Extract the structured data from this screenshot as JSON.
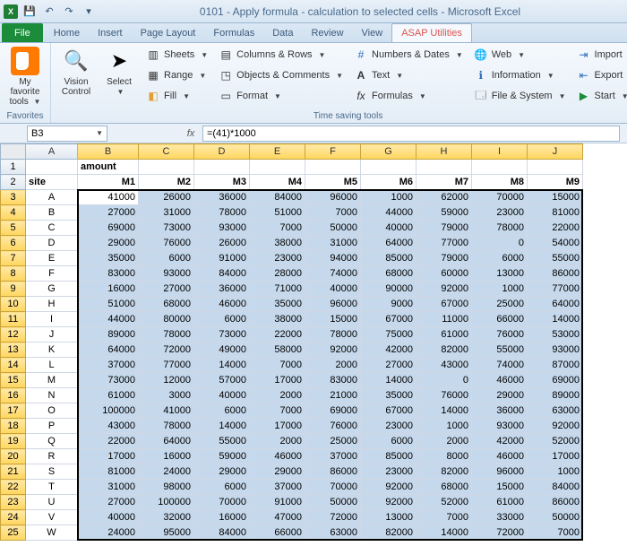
{
  "app": {
    "title": "0101 - Apply formula - calculation to selected cells  -  Microsoft Excel"
  },
  "qat": {
    "save": "💾",
    "undo": "↶",
    "redo": "↷",
    "more": "▾"
  },
  "tabs": {
    "file": "File",
    "items": [
      "Home",
      "Insert",
      "Page Layout",
      "Formulas",
      "Data",
      "Review",
      "View",
      "ASAP Utilities"
    ],
    "active": 7
  },
  "ribbon": {
    "favorites": {
      "label": "Favorites",
      "btn": "My favorite tools"
    },
    "timesaving": {
      "label": "Time saving tools",
      "vision": "Vision Control",
      "select": "Select",
      "col1": [
        "Sheets",
        "Range",
        "Fill"
      ],
      "col2": [
        "Columns & Rows",
        "Objects & Comments",
        "Format"
      ],
      "col3": [
        "Numbers & Dates",
        "Text",
        "Formulas"
      ],
      "col4": [
        "Web",
        "Information",
        "File & System"
      ],
      "col5": [
        "Import",
        "Export",
        "Start"
      ]
    }
  },
  "formula_bar": {
    "namebox": "B3",
    "fx": "fx",
    "formula": "=(41)*1000"
  },
  "grid": {
    "columns": [
      "A",
      "B",
      "C",
      "D",
      "E",
      "F",
      "G",
      "H",
      "I",
      "J"
    ],
    "row1": {
      "B": "amount"
    },
    "row2": {
      "A": "site",
      "headers": [
        "M1",
        "M2",
        "M3",
        "M4",
        "M5",
        "M6",
        "M7",
        "M8",
        "M9"
      ]
    },
    "sites": [
      "A",
      "B",
      "C",
      "D",
      "E",
      "F",
      "G",
      "H",
      "I",
      "J",
      "K",
      "L",
      "M",
      "N",
      "O",
      "P",
      "Q",
      "R",
      "S",
      "T",
      "U",
      "V",
      "W"
    ],
    "data": [
      [
        41000,
        26000,
        36000,
        84000,
        96000,
        1000,
        62000,
        70000,
        15000
      ],
      [
        27000,
        31000,
        78000,
        51000,
        7000,
        44000,
        59000,
        23000,
        81000
      ],
      [
        69000,
        73000,
        93000,
        7000,
        50000,
        40000,
        79000,
        78000,
        22000
      ],
      [
        29000,
        76000,
        26000,
        38000,
        31000,
        64000,
        77000,
        0,
        54000
      ],
      [
        35000,
        6000,
        91000,
        23000,
        94000,
        85000,
        79000,
        6000,
        55000
      ],
      [
        83000,
        93000,
        84000,
        28000,
        74000,
        68000,
        60000,
        13000,
        86000
      ],
      [
        16000,
        27000,
        36000,
        71000,
        40000,
        90000,
        92000,
        1000,
        77000
      ],
      [
        51000,
        68000,
        46000,
        35000,
        96000,
        9000,
        67000,
        25000,
        64000
      ],
      [
        44000,
        80000,
        6000,
        38000,
        15000,
        67000,
        11000,
        66000,
        14000
      ],
      [
        89000,
        78000,
        73000,
        22000,
        78000,
        75000,
        61000,
        76000,
        53000
      ],
      [
        64000,
        72000,
        49000,
        58000,
        92000,
        42000,
        82000,
        55000,
        93000
      ],
      [
        37000,
        77000,
        14000,
        7000,
        2000,
        27000,
        43000,
        74000,
        87000
      ],
      [
        73000,
        12000,
        57000,
        17000,
        83000,
        14000,
        0,
        46000,
        69000
      ],
      [
        61000,
        3000,
        40000,
        2000,
        21000,
        35000,
        76000,
        29000,
        89000
      ],
      [
        100000,
        41000,
        6000,
        7000,
        69000,
        67000,
        14000,
        36000,
        63000
      ],
      [
        43000,
        78000,
        14000,
        17000,
        76000,
        23000,
        1000,
        93000,
        92000
      ],
      [
        22000,
        64000,
        55000,
        2000,
        25000,
        6000,
        2000,
        42000,
        52000
      ],
      [
        17000,
        16000,
        59000,
        46000,
        37000,
        85000,
        8000,
        46000,
        17000
      ],
      [
        81000,
        24000,
        29000,
        29000,
        86000,
        23000,
        82000,
        96000,
        1000
      ],
      [
        31000,
        98000,
        6000,
        37000,
        70000,
        92000,
        68000,
        15000,
        84000
      ],
      [
        27000,
        100000,
        70000,
        91000,
        50000,
        92000,
        52000,
        61000,
        86000
      ],
      [
        40000,
        32000,
        16000,
        47000,
        72000,
        13000,
        7000,
        33000,
        50000
      ],
      [
        24000,
        95000,
        84000,
        66000,
        63000,
        82000,
        14000,
        72000,
        7000
      ]
    ],
    "selection": {
      "active": "B3",
      "range": "B3:J25"
    }
  },
  "chart_data": {
    "type": "table",
    "title": "amount",
    "row_labels": [
      "A",
      "B",
      "C",
      "D",
      "E",
      "F",
      "G",
      "H",
      "I",
      "J",
      "K",
      "L",
      "M",
      "N",
      "O",
      "P",
      "Q",
      "R",
      "S",
      "T",
      "U",
      "V",
      "W"
    ],
    "column_labels": [
      "M1",
      "M2",
      "M3",
      "M4",
      "M5",
      "M6",
      "M7",
      "M8",
      "M9"
    ],
    "values": [
      [
        41000,
        26000,
        36000,
        84000,
        96000,
        1000,
        62000,
        70000,
        15000
      ],
      [
        27000,
        31000,
        78000,
        51000,
        7000,
        44000,
        59000,
        23000,
        81000
      ],
      [
        69000,
        73000,
        93000,
        7000,
        50000,
        40000,
        79000,
        78000,
        22000
      ],
      [
        29000,
        76000,
        26000,
        38000,
        31000,
        64000,
        77000,
        0,
        54000
      ],
      [
        35000,
        6000,
        91000,
        23000,
        94000,
        85000,
        79000,
        6000,
        55000
      ],
      [
        83000,
        93000,
        84000,
        28000,
        74000,
        68000,
        60000,
        13000,
        86000
      ],
      [
        16000,
        27000,
        36000,
        71000,
        40000,
        90000,
        92000,
        1000,
        77000
      ],
      [
        51000,
        68000,
        46000,
        35000,
        96000,
        9000,
        67000,
        25000,
        64000
      ],
      [
        44000,
        80000,
        6000,
        38000,
        15000,
        67000,
        11000,
        66000,
        14000
      ],
      [
        89000,
        78000,
        73000,
        22000,
        78000,
        75000,
        61000,
        76000,
        53000
      ],
      [
        64000,
        72000,
        49000,
        58000,
        92000,
        42000,
        82000,
        55000,
        93000
      ],
      [
        37000,
        77000,
        14000,
        7000,
        2000,
        27000,
        43000,
        74000,
        87000
      ],
      [
        73000,
        12000,
        57000,
        17000,
        83000,
        14000,
        0,
        46000,
        69000
      ],
      [
        61000,
        3000,
        40000,
        2000,
        21000,
        35000,
        76000,
        29000,
        89000
      ],
      [
        100000,
        41000,
        6000,
        7000,
        69000,
        67000,
        14000,
        36000,
        63000
      ],
      [
        43000,
        78000,
        14000,
        17000,
        76000,
        23000,
        1000,
        93000,
        92000
      ],
      [
        22000,
        64000,
        55000,
        2000,
        25000,
        6000,
        2000,
        42000,
        52000
      ],
      [
        17000,
        16000,
        59000,
        46000,
        37000,
        85000,
        8000,
        46000,
        17000
      ],
      [
        81000,
        24000,
        29000,
        29000,
        86000,
        23000,
        82000,
        96000,
        1000
      ],
      [
        31000,
        98000,
        6000,
        37000,
        70000,
        92000,
        68000,
        15000,
        84000
      ],
      [
        27000,
        100000,
        70000,
        91000,
        50000,
        92000,
        52000,
        61000,
        86000
      ],
      [
        40000,
        32000,
        16000,
        47000,
        72000,
        13000,
        7000,
        33000,
        50000
      ],
      [
        24000,
        95000,
        84000,
        66000,
        63000,
        82000,
        14000,
        72000,
        7000
      ]
    ]
  }
}
